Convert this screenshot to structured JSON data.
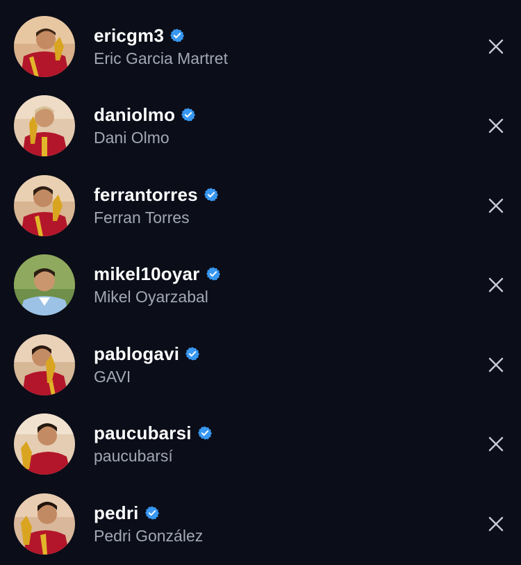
{
  "colors": {
    "background": "#0b0d18",
    "username": "#ffffff",
    "fullname": "#a3a7b6",
    "verified_badge": "#3897f0",
    "close_icon": "#c9ccd6"
  },
  "accounts": [
    {
      "username": "ericgm3",
      "fullname": "Eric Garcia Martret",
      "verified": true,
      "avatar": "avatar-photo-trophy",
      "action_icon": "close-icon"
    },
    {
      "username": "daniolmo",
      "fullname": "Dani Olmo",
      "verified": true,
      "avatar": "avatar-photo-trophy",
      "action_icon": "close-icon"
    },
    {
      "username": "ferrantorres",
      "fullname": "Ferran Torres",
      "verified": true,
      "avatar": "avatar-photo-trophy",
      "action_icon": "close-icon"
    },
    {
      "username": "mikel10oyar",
      "fullname": "Mikel Oyarzabal",
      "verified": true,
      "avatar": "avatar-photo-outdoor",
      "action_icon": "close-icon"
    },
    {
      "username": "pablogavi",
      "fullname": "GAVI",
      "verified": true,
      "avatar": "avatar-photo-trophy",
      "action_icon": "close-icon"
    },
    {
      "username": "paucubarsi",
      "fullname": "paucubarsí",
      "verified": true,
      "avatar": "avatar-photo-trophy",
      "action_icon": "close-icon"
    },
    {
      "username": "pedri",
      "fullname": "Pedri González",
      "verified": true,
      "avatar": "avatar-photo-trophy",
      "action_icon": "close-icon"
    }
  ]
}
